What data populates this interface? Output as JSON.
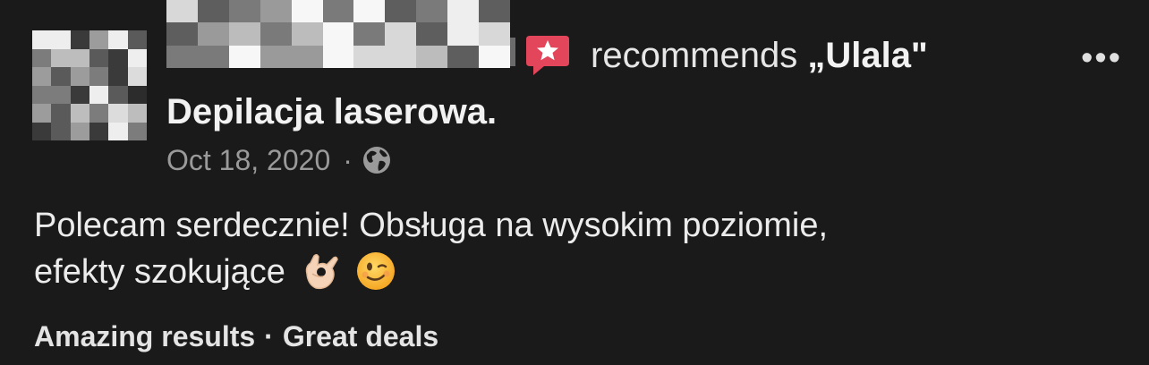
{
  "post": {
    "recommend_verb": "recommends",
    "business_name": "„Ulala\"",
    "more_label": "•••",
    "title": "Depilacja laserowa.",
    "date": "Oct 18, 2020",
    "meta_separator": "·",
    "privacy_icon": "globe-icon",
    "body_line1": "Polecam serdecznie! Obsługa na wysokim poziomie,",
    "body_line2": "efekty szokujące",
    "emojis": [
      "ok-hand-emoji",
      "winking-face-emoji"
    ],
    "tags": [
      "Amazing results",
      "Great deals"
    ],
    "tag_separator": "·"
  },
  "colors": {
    "background": "#1a1a1b",
    "recommend_icon": "#e3455a",
    "secondary_text": "#9a9a9a"
  }
}
